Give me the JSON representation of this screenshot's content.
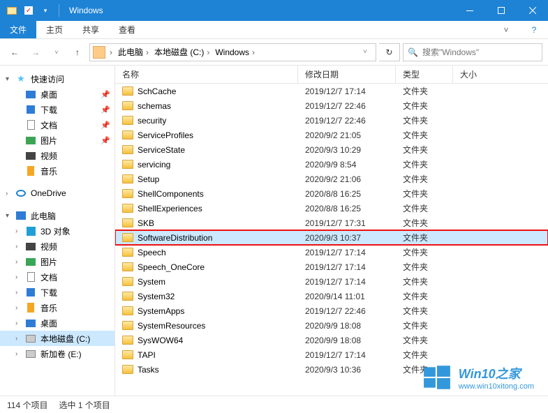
{
  "title": "Windows",
  "ribbon": {
    "file": "文件",
    "home": "主页",
    "share": "共享",
    "view": "查看"
  },
  "breadcrumb": [
    "此电脑",
    "本地磁盘 (C:)",
    "Windows"
  ],
  "search": {
    "placeholder": "搜索\"Windows\""
  },
  "sidebar": {
    "quick": "快速访问",
    "items": [
      {
        "label": "桌面",
        "icon": "ic-desk",
        "pin": true
      },
      {
        "label": "下载",
        "icon": "ic-dl",
        "pin": true
      },
      {
        "label": "文档",
        "icon": "ic-doc",
        "pin": true
      },
      {
        "label": "图片",
        "icon": "ic-pic",
        "pin": true
      },
      {
        "label": "视频",
        "icon": "ic-vid",
        "pin": false
      },
      {
        "label": "音乐",
        "icon": "ic-mus",
        "pin": false
      }
    ],
    "onedrive": "OneDrive",
    "thispc": "此电脑",
    "pcitems": [
      {
        "label": "3D 对象",
        "icon": "ic-3d"
      },
      {
        "label": "视频",
        "icon": "ic-vid"
      },
      {
        "label": "图片",
        "icon": "ic-pic"
      },
      {
        "label": "文档",
        "icon": "ic-doc"
      },
      {
        "label": "下载",
        "icon": "ic-dl"
      },
      {
        "label": "音乐",
        "icon": "ic-mus"
      },
      {
        "label": "桌面",
        "icon": "ic-desk"
      },
      {
        "label": "本地磁盘 (C:)",
        "icon": "ic-disk",
        "selected": true
      },
      {
        "label": "新加卷 (E:)",
        "icon": "ic-disk"
      }
    ]
  },
  "columns": {
    "name": "名称",
    "date": "修改日期",
    "type": "类型",
    "size": "大小"
  },
  "foldertype": "文件夹",
  "files": [
    {
      "name": "SchCache",
      "date": "2019/12/7 17:14"
    },
    {
      "name": "schemas",
      "date": "2019/12/7 22:46"
    },
    {
      "name": "security",
      "date": "2019/12/7 22:46"
    },
    {
      "name": "ServiceProfiles",
      "date": "2020/9/2 21:05"
    },
    {
      "name": "ServiceState",
      "date": "2020/9/3 10:29"
    },
    {
      "name": "servicing",
      "date": "2020/9/9 8:54"
    },
    {
      "name": "Setup",
      "date": "2020/9/2 21:06"
    },
    {
      "name": "ShellComponents",
      "date": "2020/8/8 16:25"
    },
    {
      "name": "ShellExperiences",
      "date": "2020/8/8 16:25"
    },
    {
      "name": "SKB",
      "date": "2019/12/7 17:31"
    },
    {
      "name": "SoftwareDistribution",
      "date": "2020/9/3 10:37",
      "selected": true,
      "hl": true
    },
    {
      "name": "Speech",
      "date": "2019/12/7 17:14"
    },
    {
      "name": "Speech_OneCore",
      "date": "2019/12/7 17:14"
    },
    {
      "name": "System",
      "date": "2019/12/7 17:14"
    },
    {
      "name": "System32",
      "date": "2020/9/14 11:01"
    },
    {
      "name": "SystemApps",
      "date": "2019/12/7 22:46"
    },
    {
      "name": "SystemResources",
      "date": "2020/9/9 18:08"
    },
    {
      "name": "SysWOW64",
      "date": "2020/9/9 18:08"
    },
    {
      "name": "TAPI",
      "date": "2019/12/7 17:14"
    },
    {
      "name": "Tasks",
      "date": "2020/9/3 10:36"
    }
  ],
  "status": {
    "count": "114 个项目",
    "selected": "选中 1 个项目"
  },
  "watermark": {
    "title": "Win10之家",
    "url": "www.win10xitong.com"
  }
}
